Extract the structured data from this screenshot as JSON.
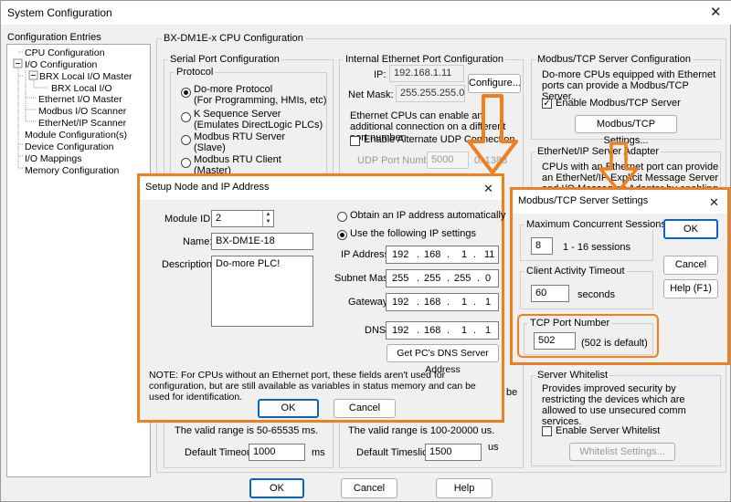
{
  "window": {
    "title": "System Configuration"
  },
  "tree": {
    "title": "Configuration Entries",
    "items": [
      "CPU Configuration",
      "I/O Configuration",
      "BRX Local I/O Master",
      "BRX Local I/O",
      "Ethernet I/O Master",
      "Modbus I/O Scanner",
      "EtherNet/IP Scanner",
      "Module Configuration(s)",
      "Device Configuration",
      "I/O Mappings",
      "Memory Configuration"
    ]
  },
  "cpu_config": {
    "title": "BX-DM1E-x CPU Configuration",
    "serial_port": {
      "title": "Serial Port Configuration",
      "protocol_title": "Protocol",
      "options": [
        {
          "line1": "Do-more Protocol",
          "line2": "(For Programming, HMIs, etc)",
          "selected": true
        },
        {
          "line1": "K Sequence Server",
          "line2": "(Emulates DirectLogic PLCs)",
          "selected": false
        },
        {
          "line1": "Modbus RTU Server",
          "line2": "(Slave)",
          "selected": false
        },
        {
          "line1": "Modbus RTU Client",
          "line2": "(Master)",
          "selected": false
        }
      ],
      "valid_range": "The valid range is 50-65535 ms.",
      "default_timeout_label": "Default Timeout:",
      "default_timeout_value": "1000",
      "default_timeout_unit": "ms"
    },
    "ethernet": {
      "title": "Internal Ethernet Port Configuration",
      "ip_label": "IP:",
      "ip_value": "192.168.1.11",
      "netmask_label": "Net Mask:",
      "netmask_value": "255.255.255.0",
      "configure_button": "Configure...",
      "desc": "Ethernet CPUs can enable an additional connection on a different port number.",
      "alt_udp_label": "Enable Alternate UDP Connection",
      "udp_port_label": "UDP Port Number:",
      "udp_port_value": "5000",
      "udp_port_right": "0x1388",
      "valid_range": "The valid range is 100-20000 us.",
      "default_timeslice_label": "Default Timeslice:",
      "default_timeslice_value": "1500",
      "default_timeslice_unit": "us",
      "tail_be": "be"
    },
    "modbus_server": {
      "title": "Modbus/TCP Server Configuration",
      "desc": "Do-more CPUs equipped with Ethernet ports can provide a Modbus/TCP Server.",
      "enable_label": "Enable Modbus/TCP Server",
      "settings_button": "Modbus/TCP Settings..."
    },
    "enip": {
      "title": "EtherNet/IP Server Adapter",
      "desc": "CPUs with an Ethernet port can provide an EtherNet/IP Explicit Message Server and I/O Messaging Adapter by enabling access to"
    },
    "whitelist": {
      "title": "Server Whitelist",
      "desc": "Provides improved security by restricting the devices which are allowed to use unsecured comm services.",
      "enable_label": "Enable Server Whitelist",
      "settings_button": "Whitelist Settings..."
    }
  },
  "bottom_buttons": {
    "ok": "OK",
    "cancel": "Cancel",
    "help": "Help"
  },
  "node_dialog": {
    "title": "Setup Node and IP Address",
    "module_id_label": "Module ID:",
    "module_id_value": "2",
    "name_label": "Name:",
    "name_value": "BX-DM1E-18",
    "description_label": "Description:",
    "description_value": "Do-more PLC!",
    "obtain_auto": "Obtain an IP address automatically",
    "use_following": "Use the following IP settings",
    "ip_address_label": "IP Address:",
    "ip_address": [
      "192",
      "168",
      "1",
      "11"
    ],
    "subnet_label": "Subnet Mask:",
    "subnet": [
      "255",
      "255",
      "255",
      "0"
    ],
    "gateway_label": "Gateway:",
    "gateway": [
      "192",
      "168",
      "1",
      "1"
    ],
    "dns_label": "DNS:",
    "dns": [
      "192",
      "168",
      "1",
      "1"
    ],
    "dns_button": "Get PC's DNS Server Address",
    "note": "NOTE: For CPUs without an Ethernet port, these fields aren't used for configuration, but are still available as variables in status memory and can be used for identification.",
    "ok": "OK",
    "cancel": "Cancel"
  },
  "modbus_dialog": {
    "title": "Modbus/TCP Server Settings",
    "max_sessions_title": "Maximum Concurrent Sessions",
    "max_sessions_value": "8",
    "max_sessions_hint": "1 - 16 sessions",
    "timeout_title": "Client Activity Timeout",
    "timeout_value": "60",
    "timeout_unit": "seconds",
    "port_title": "TCP Port Number",
    "port_value": "502",
    "port_hint": "(502 is default)",
    "ok": "OK",
    "cancel": "Cancel",
    "help": "Help (F1)"
  },
  "colors": {
    "highlight": "#f07f1e",
    "default_button_border": "#0a64c8"
  }
}
